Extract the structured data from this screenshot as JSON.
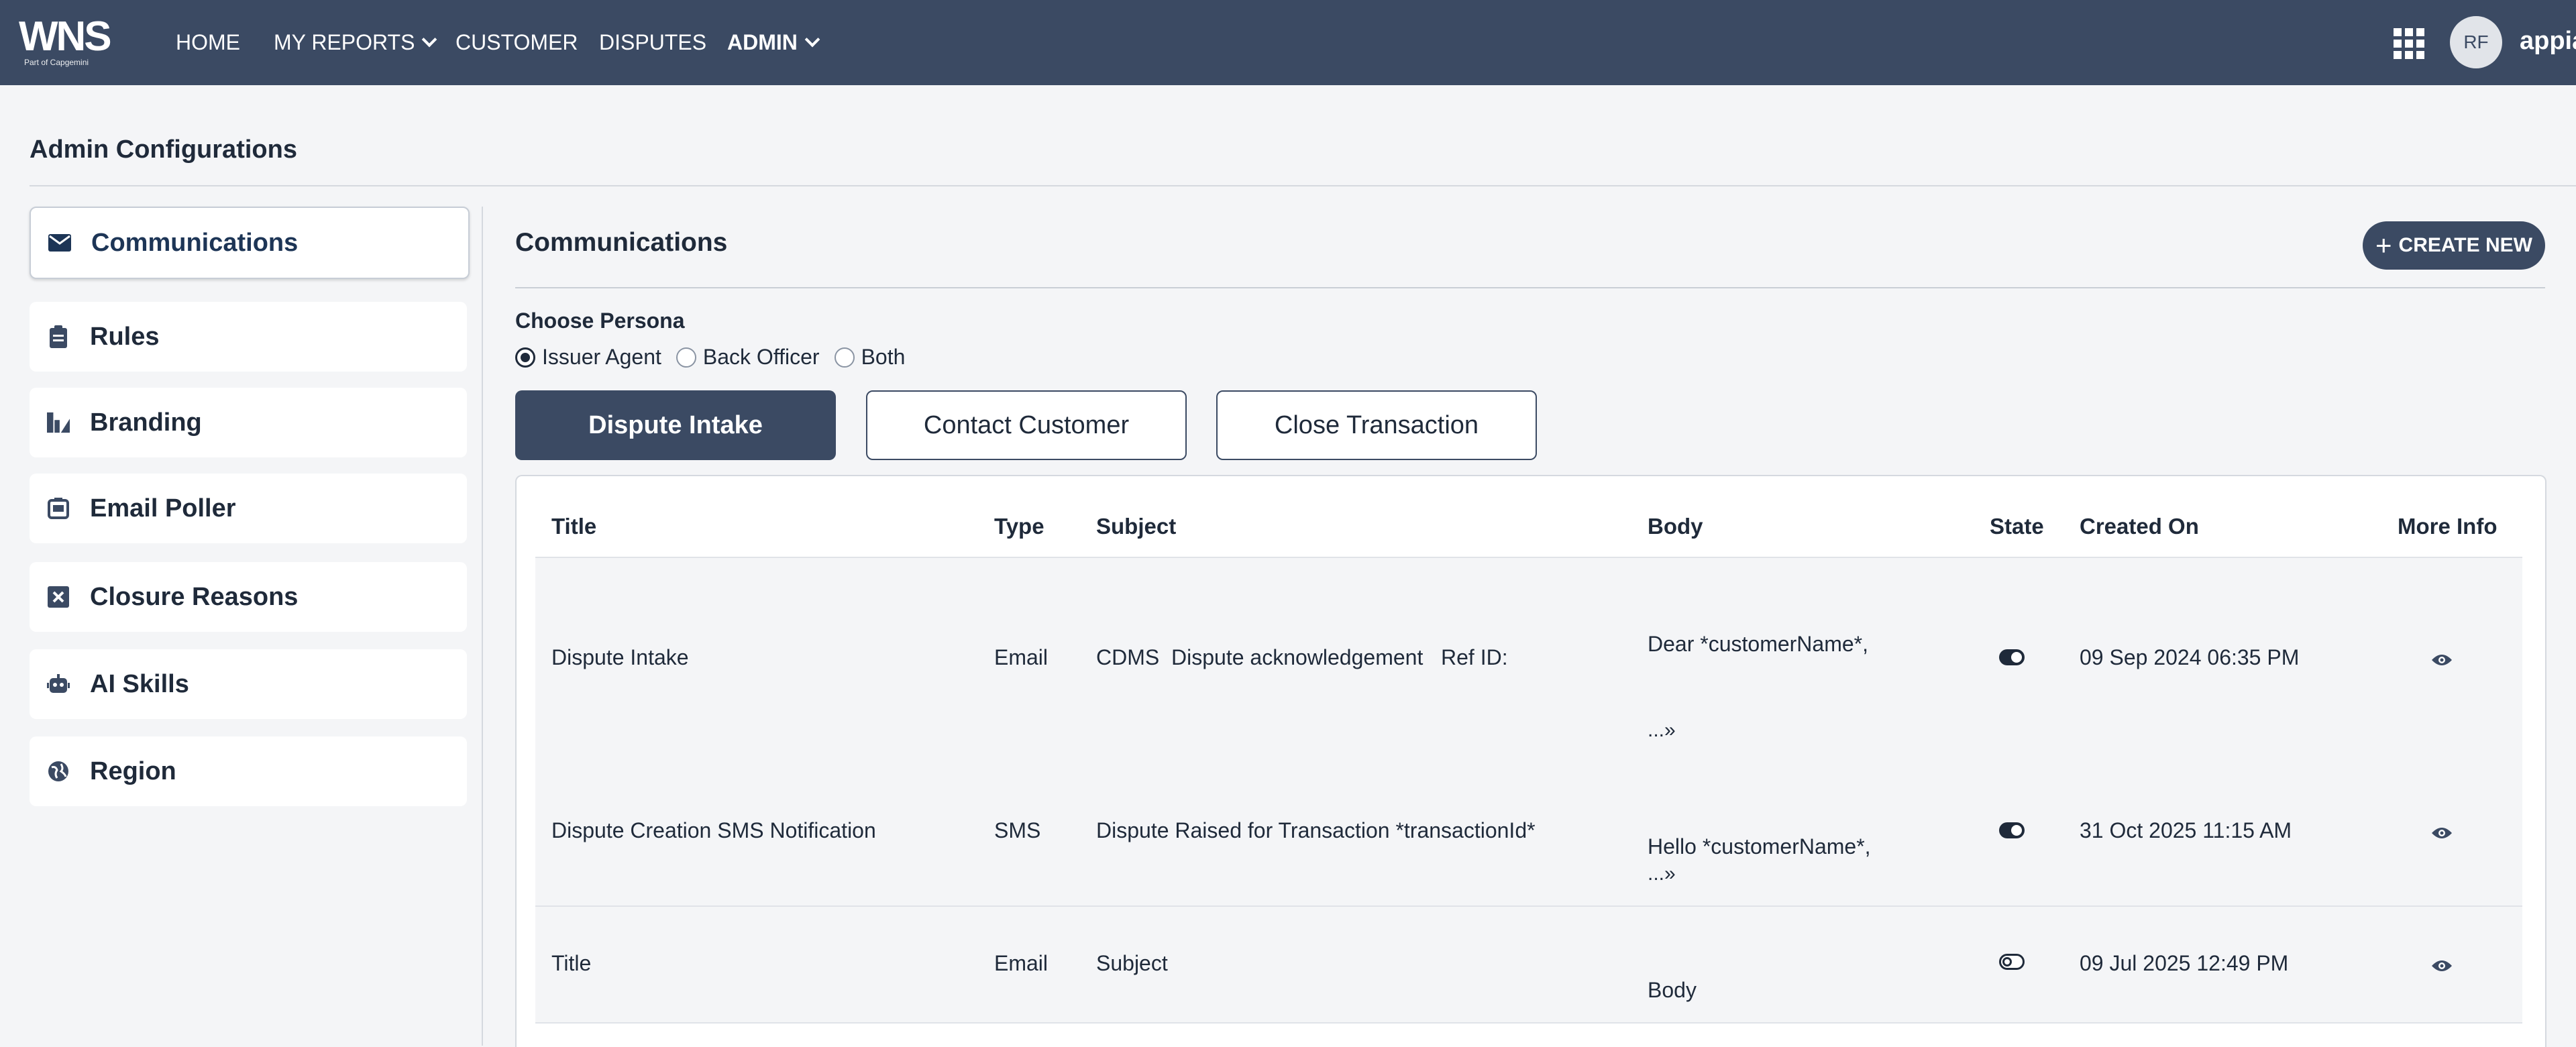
{
  "brand": {
    "logo_text": "WNS",
    "logo_tagline": "Part of Capgemini"
  },
  "nav": {
    "items": [
      {
        "label": "HOME"
      },
      {
        "label": "MY REPORTS"
      },
      {
        "label": "CUSTOMER"
      },
      {
        "label": "DISPUTES"
      },
      {
        "label": "ADMIN"
      }
    ]
  },
  "user": {
    "initials": "RF",
    "name": "appian"
  },
  "page": {
    "title": "Admin Configurations"
  },
  "sidebar": {
    "items": [
      {
        "label": "Communications",
        "icon": "envelope-icon",
        "active": true
      },
      {
        "label": "Rules",
        "icon": "clipboard-icon"
      },
      {
        "label": "Branding",
        "icon": "branding-icon"
      },
      {
        "label": "Email Poller",
        "icon": "email-poller-icon"
      },
      {
        "label": "Closure Reasons",
        "icon": "x-square-icon"
      },
      {
        "label": "AI Skills",
        "icon": "robot-icon"
      },
      {
        "label": "Region",
        "icon": "globe-icon"
      }
    ]
  },
  "main": {
    "title": "Communications",
    "create_label": "CREATE NEW",
    "persona_label": "Choose Persona",
    "personas": [
      {
        "label": "Issuer Agent",
        "checked": true
      },
      {
        "label": "Back Officer",
        "checked": false
      },
      {
        "label": "Both",
        "checked": false
      }
    ],
    "tabs": [
      {
        "label": "Dispute Intake",
        "active": true
      },
      {
        "label": "Contact Customer",
        "active": false
      },
      {
        "label": "Close Transaction",
        "active": false
      }
    ]
  },
  "table": {
    "columns": [
      "Title",
      "Type",
      "Subject",
      "Body",
      "State",
      "Created On",
      "More Info"
    ],
    "rows": [
      {
        "title": "Dispute Intake",
        "type": "Email",
        "subject": "CDMS  Dispute acknowledgement   Ref ID:",
        "body": "Dear *customerName*,",
        "more": "...»",
        "state": "on",
        "created": "09 Sep 2024 06:35 PM"
      },
      {
        "title": "Dispute Creation SMS Notification",
        "type": "SMS",
        "subject": "Dispute Raised for Transaction *transactionId*",
        "body": "Hello *customerName*,",
        "more": "...»",
        "state": "on",
        "created": "31 Oct 2025 11:15 AM"
      },
      {
        "title": "Title",
        "type": "Email",
        "subject": "Subject",
        "body": "Body",
        "state": "off",
        "created": "09 Jul 2025 12:49 PM"
      }
    ]
  },
  "colors": {
    "topbar": "#3b4a63",
    "accent": "#3b4a63",
    "background": "#f4f5f7"
  }
}
